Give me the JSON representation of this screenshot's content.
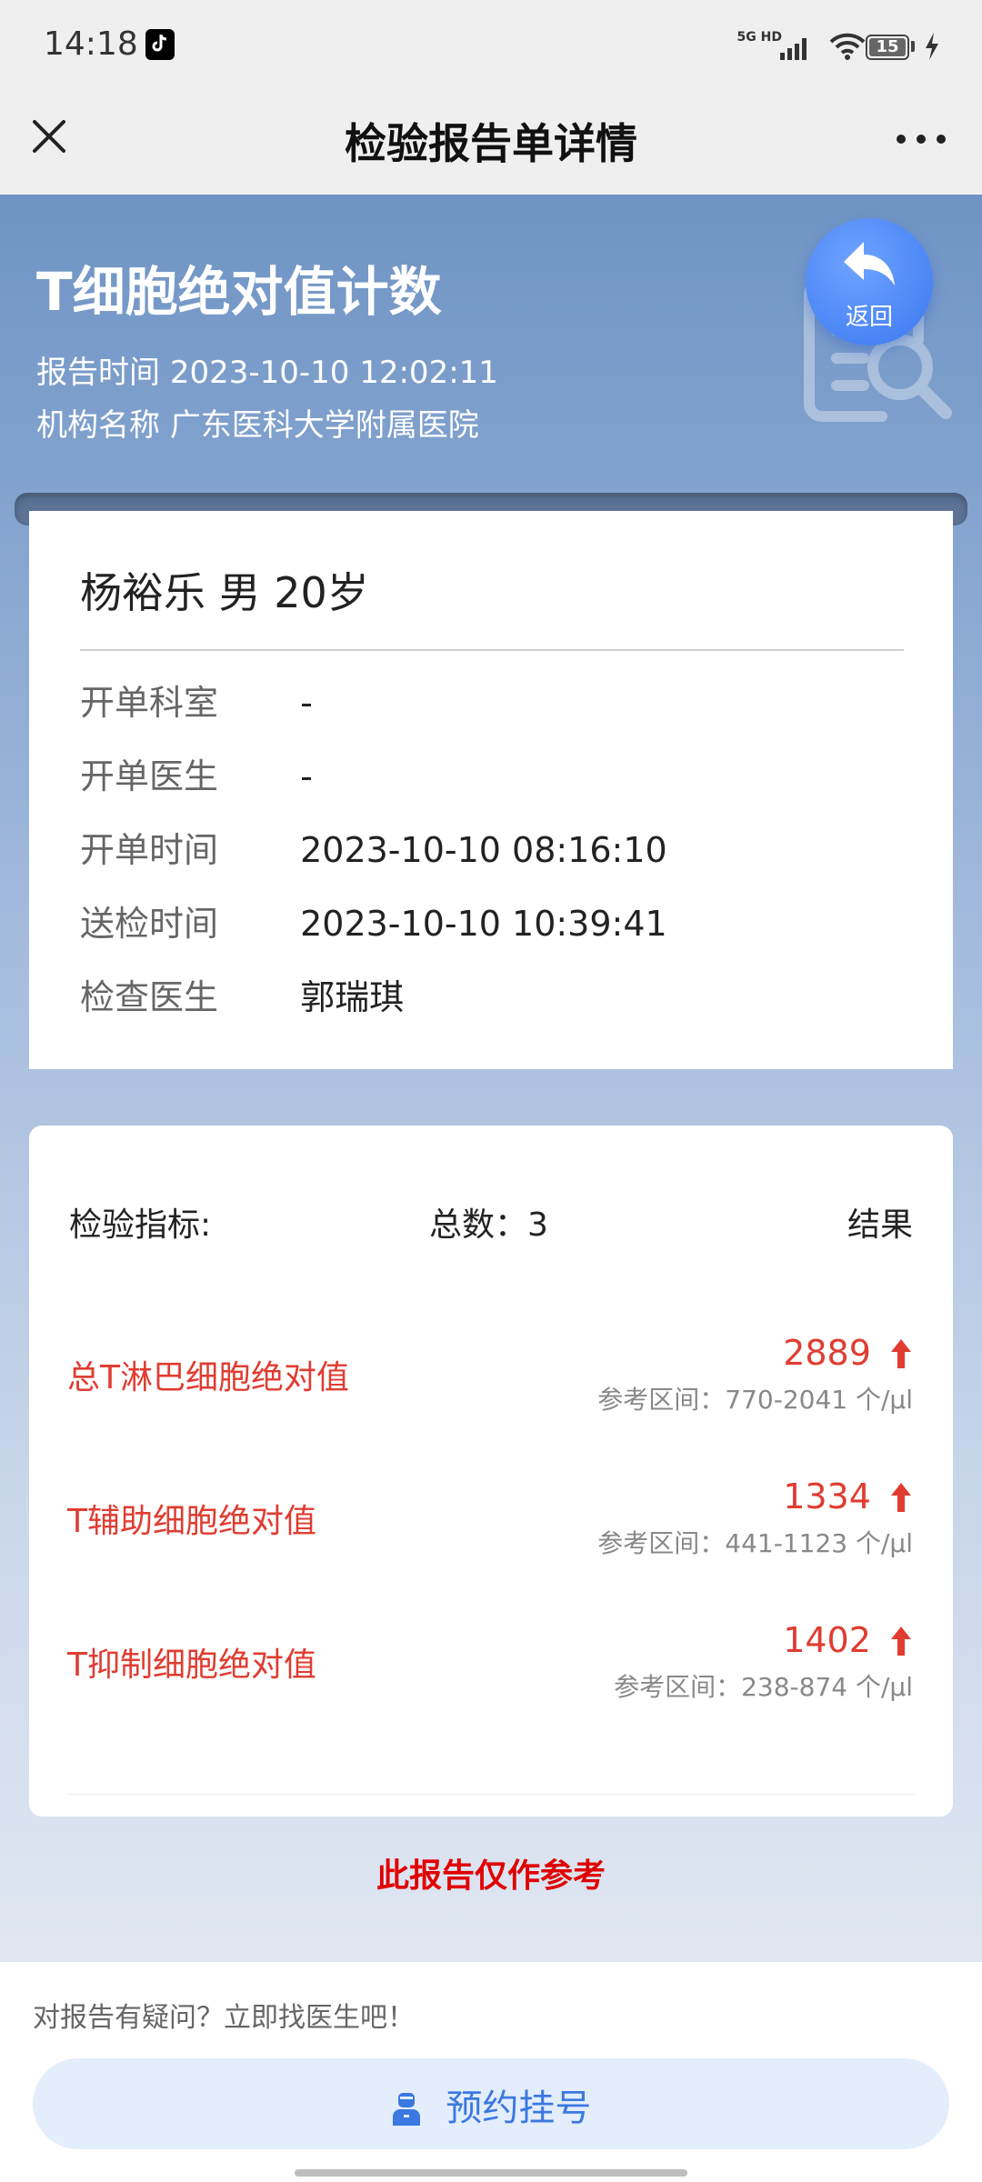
{
  "status_bar": {
    "time": "14:18",
    "network": "5G HD",
    "battery": "15"
  },
  "title_bar": {
    "title": "检验报告单详情"
  },
  "header": {
    "report_title": "T细胞绝对值计数",
    "report_time_label": "报告时间",
    "report_time": "2023-10-10 12:02:11",
    "institution_label": "机构名称",
    "institution": "广东医科大学附属医院",
    "back_label": "返回"
  },
  "patient": {
    "summary": "杨裕乐 男 20岁",
    "rows": [
      {
        "label": "开单科室",
        "value": "-"
      },
      {
        "label": "开单医生",
        "value": "-"
      },
      {
        "label": "开单时间",
        "value": "2023-10-10 08:16:10"
      },
      {
        "label": "送检时间",
        "value": "2023-10-10 10:39:41"
      },
      {
        "label": "检查医生",
        "value": "郭瑞琪"
      }
    ]
  },
  "results": {
    "indicator_label": "检验指标:",
    "total_label": "总数：3",
    "result_label": "结果",
    "items": [
      {
        "name": "总T淋巴细胞绝对值",
        "value": "2889",
        "ref": "参考区间：770-2041 个/μl",
        "flag": "up"
      },
      {
        "name": "T辅助细胞绝对值",
        "value": "1334",
        "ref": "参考区间：441-1123 个/μl",
        "flag": "up"
      },
      {
        "name": "T抑制细胞绝对值",
        "value": "1402",
        "ref": "参考区间：238-874 个/μl",
        "flag": "up"
      }
    ]
  },
  "disclaimer": "此报告仅作参考",
  "footer": {
    "hint": "对报告有疑问？立即找医生吧！",
    "book_label": "预约挂号"
  },
  "colors": {
    "accent": "#3b78e0",
    "alert": "#e03c31"
  }
}
